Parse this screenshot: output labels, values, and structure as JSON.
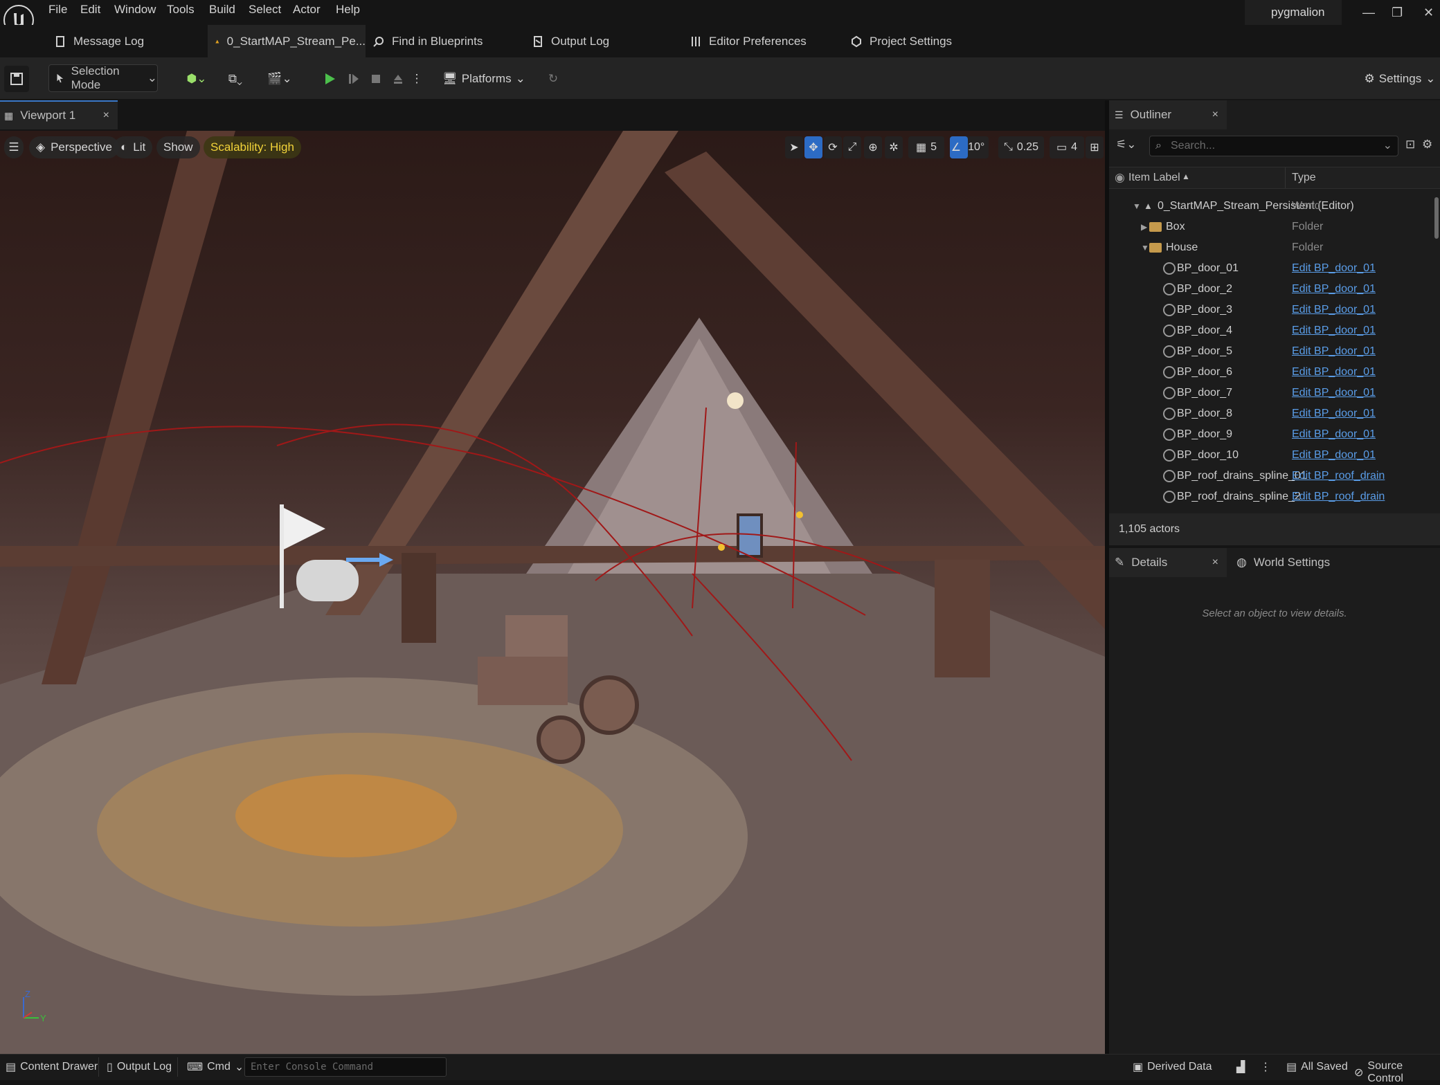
{
  "app": {
    "user": "pygmalion"
  },
  "menu": [
    "File",
    "Edit",
    "Window",
    "Tools",
    "Build",
    "Select",
    "Actor",
    "Help"
  ],
  "doc_tabs": [
    "Message Log",
    "0_StartMAP_Stream_Pe...",
    "Find in Blueprints",
    "Output Log",
    "Editor Preferences",
    "Project Settings"
  ],
  "toolbar": {
    "mode": "Selection Mode",
    "platforms": "Platforms",
    "settings": "Settings"
  },
  "viewport": {
    "tab": "Viewport 1",
    "perspective": "Perspective",
    "lit": "Lit",
    "show": "Show",
    "scalability": "Scalability: High",
    "grid_snap": "5",
    "rotation_snap": "10°",
    "scale_snap": "0.25",
    "camera_speed": "4",
    "axis_z": "Z",
    "axis_y": "Y"
  },
  "outliner": {
    "tab": "Outliner",
    "search_placeholder": "Search...",
    "col_label": "Item Label",
    "col_type": "Type",
    "rows": [
      {
        "label": "0_StartMAP_Stream_Persistent (Editor)",
        "type": "World"
      },
      {
        "label": "Box",
        "type": "Folder"
      },
      {
        "label": "House",
        "type": "Folder"
      },
      {
        "label": "BP_door_01",
        "type": "Edit BP_door_01"
      },
      {
        "label": "BP_door_2",
        "type": "Edit BP_door_01"
      },
      {
        "label": "BP_door_3",
        "type": "Edit BP_door_01"
      },
      {
        "label": "BP_door_4",
        "type": "Edit BP_door_01"
      },
      {
        "label": "BP_door_5",
        "type": "Edit BP_door_01"
      },
      {
        "label": "BP_door_6",
        "type": "Edit BP_door_01"
      },
      {
        "label": "BP_door_7",
        "type": "Edit BP_door_01"
      },
      {
        "label": "BP_door_8",
        "type": "Edit BP_door_01"
      },
      {
        "label": "BP_door_9",
        "type": "Edit BP_door_01"
      },
      {
        "label": "BP_door_10",
        "type": "Edit BP_door_01"
      },
      {
        "label": "BP_roof_drains_spline_01",
        "type": "Edit BP_roof_drain"
      },
      {
        "label": "BP_roof_drains_spline_2",
        "type": "Edit BP_roof_drain"
      }
    ],
    "actor_count": "1,105 actors"
  },
  "details": {
    "tab": "Details",
    "world_tab": "World Settings",
    "hint": "Select an object to view details."
  },
  "statusbar": {
    "content_drawer": "Content Drawer",
    "output_log": "Output Log",
    "cmd": "Cmd",
    "console_placeholder": "Enter Console Command",
    "derived_data": "Derived Data",
    "all_saved": "All Saved",
    "source_control": "Source Control"
  },
  "colors": {
    "accent": "#2c6bc4",
    "play": "#4cc04c",
    "link": "#5a9de8",
    "scalability": "#f2d33a"
  }
}
